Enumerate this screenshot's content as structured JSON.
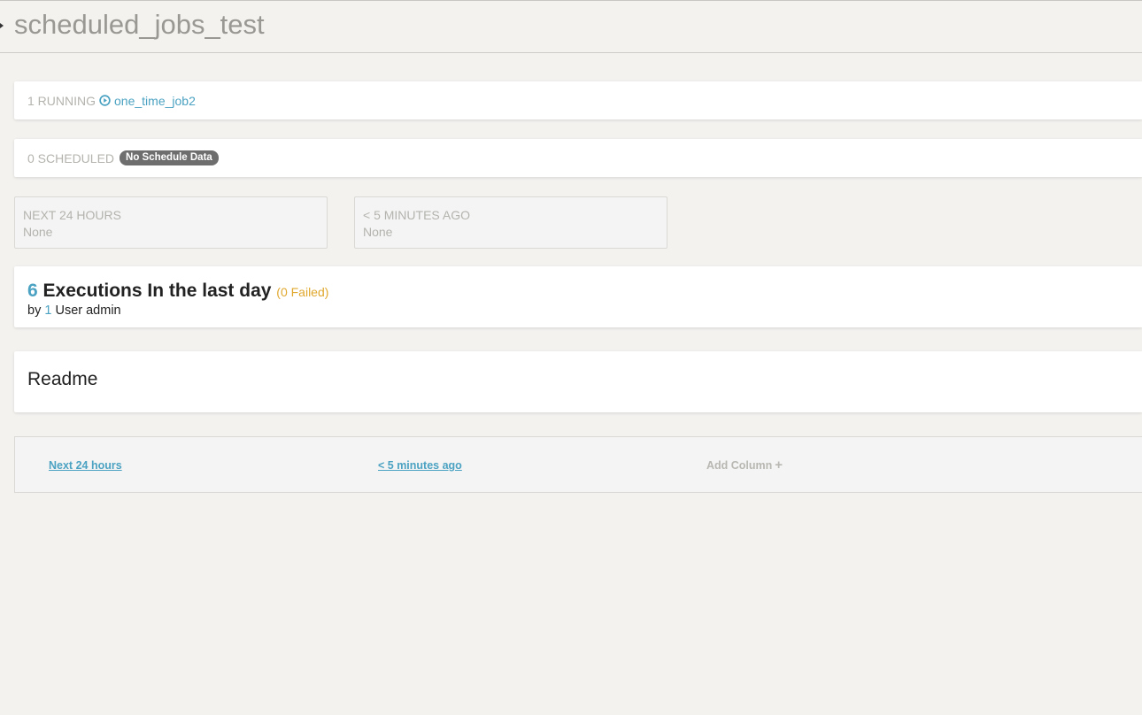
{
  "header": {
    "title": "scheduled_jobs_test"
  },
  "running": {
    "count_label": "1 RUNNING",
    "job_icon": "play-circle-icon",
    "job_name": "one_time_job2"
  },
  "scheduled": {
    "count_label": "0 SCHEDULED",
    "badge": "No Schedule Data"
  },
  "stats": [
    {
      "label": "NEXT 24 HOURS",
      "value": "None"
    },
    {
      "label": "< 5 MINUTES AGO",
      "value": "None"
    }
  ],
  "executions": {
    "count": "6",
    "heading": "Executions In the last day",
    "failed": "(0 Failed)",
    "by_prefix": "by",
    "user_count": "1",
    "user_suffix": "User admin"
  },
  "readme": {
    "title": "Readme"
  },
  "columns": {
    "col1": "Next 24 hours",
    "col2": "< 5 minutes ago",
    "add_label": "Add Column",
    "add_icon": "plus-icon"
  },
  "colors": {
    "accent": "#4ba2c2",
    "warning": "#e0a82e",
    "background": "#f3f2ef"
  }
}
